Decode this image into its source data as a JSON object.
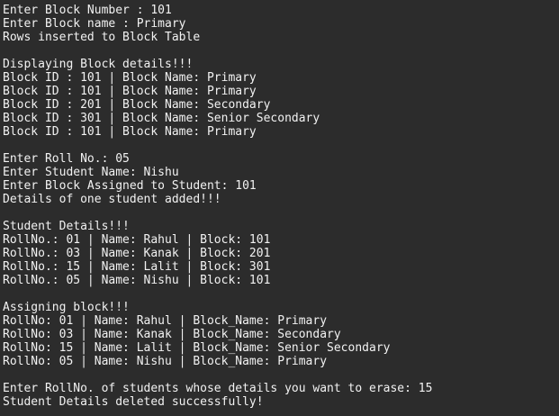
{
  "terminal": {
    "lines": [
      "Enter Block Number : 101",
      "Enter Block name : Primary",
      "Rows inserted to Block Table",
      "",
      "Displaying Block details!!!",
      "Block ID : 101 | Block Name: Primary",
      "Block ID : 101 | Block Name: Primary",
      "Block ID : 201 | Block Name: Secondary",
      "Block ID : 301 | Block Name: Senior Secondary",
      "Block ID : 101 | Block Name: Primary",
      "",
      "Enter Roll No.: 05",
      "Enter Student Name: Nishu",
      "Enter Block Assigned to Student: 101",
      "Details of one student added!!!",
      "",
      "Student Details!!!",
      "RollNo.: 01 | Name: Rahul | Block: 101",
      "RollNo.: 03 | Name: Kanak | Block: 201",
      "RollNo.: 15 | Name: Lalit | Block: 301",
      "RollNo.: 05 | Name: Nishu | Block: 101",
      "",
      "Assigning block!!!",
      "RollNo: 01 | Name: Rahul | Block_Name: Primary",
      "RollNo: 03 | Name: Kanak | Block_Name: Secondary",
      "RollNo: 15 | Name: Lalit | Block_Name: Senior Secondary",
      "RollNo: 05 | Name: Nishu | Block_Name: Primary",
      "",
      "Enter RollNo. of students whose details you want to erase: 15",
      "Student Details deleted successfully!"
    ]
  }
}
